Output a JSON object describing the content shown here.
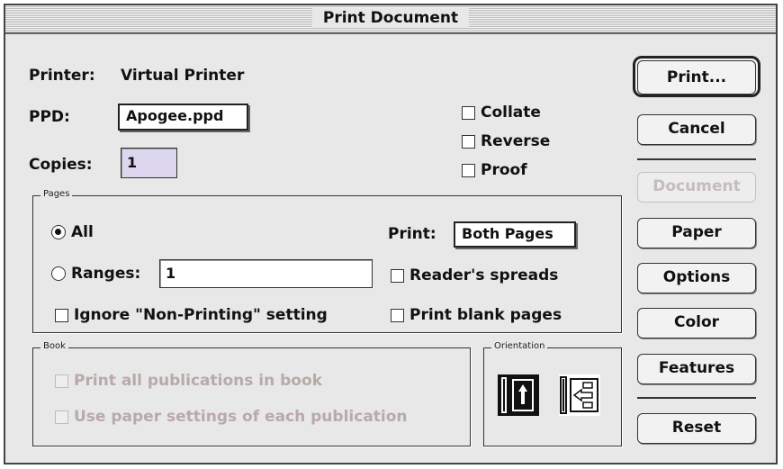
{
  "window": {
    "title": "Print Document"
  },
  "printer": {
    "label": "Printer:",
    "value": "Virtual Printer"
  },
  "ppd": {
    "label": "PPD:",
    "value": "Apogee.ppd"
  },
  "copies": {
    "label": "Copies:",
    "value": "1"
  },
  "options": {
    "collate": {
      "label": "Collate",
      "checked": false
    },
    "reverse": {
      "label": "Reverse",
      "checked": false
    },
    "proof": {
      "label": "Proof",
      "checked": false
    }
  },
  "pages": {
    "legend": "Pages",
    "all_label": "All",
    "ranges_label": "Ranges:",
    "ranges_value": "1",
    "selected": "All",
    "print_label": "Print:",
    "print_value": "Both Pages",
    "readers_spreads": "Reader's spreads",
    "ignore_nonprinting": "Ignore \"Non-Printing\" setting",
    "print_blank": "Print blank pages"
  },
  "book": {
    "legend": "Book",
    "print_all": "Print all publications in book",
    "use_paper": "Use paper settings of each publication"
  },
  "orientation": {
    "legend": "Orientation",
    "options": [
      "portrait-icon",
      "landscape-icon"
    ]
  },
  "buttons": {
    "print": "Print...",
    "cancel": "Cancel",
    "document": "Document",
    "paper": "Paper",
    "options": "Options",
    "color": "Color",
    "features": "Features",
    "reset": "Reset"
  },
  "colors": {
    "window_bg": "#e8e8e8",
    "disabled_text": "#b9a9a9",
    "field_ppd_bg": "#ffffff",
    "copies_bg": "#dcd6ef"
  }
}
